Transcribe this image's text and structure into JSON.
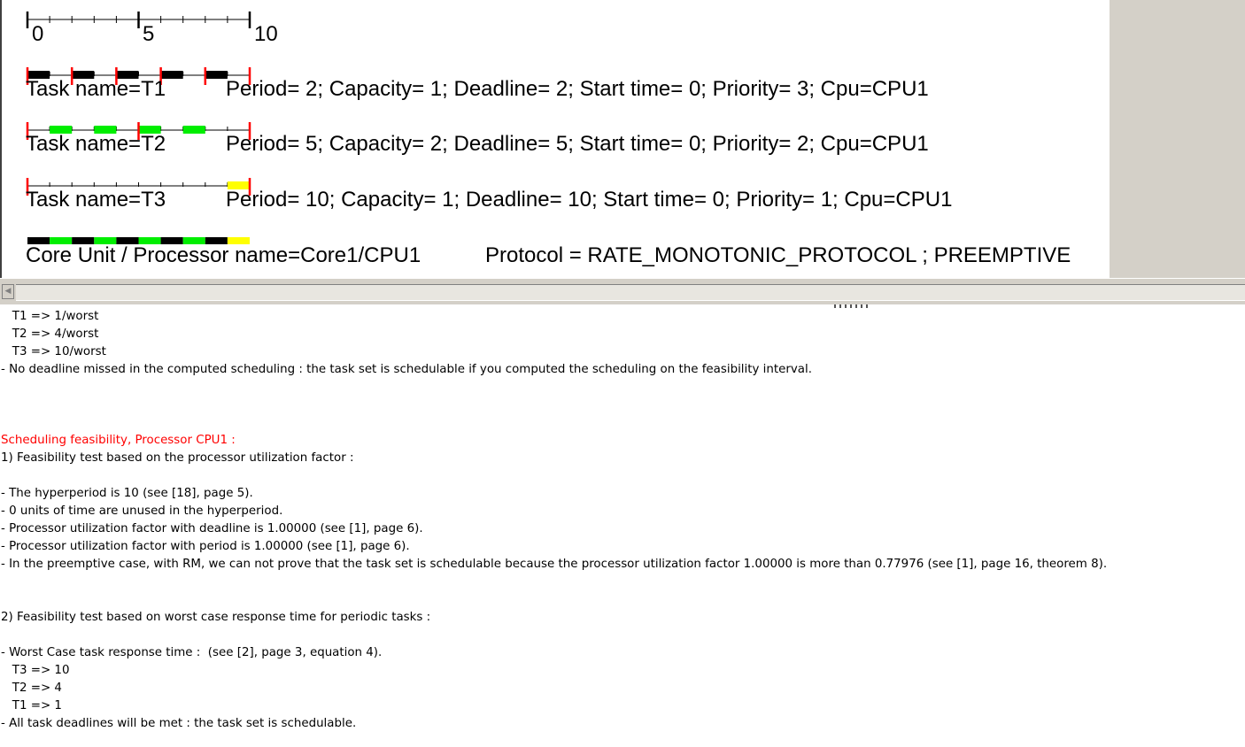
{
  "gantt": {
    "axis": {
      "start": 0,
      "end": 10,
      "labels": [
        "0",
        "5",
        "10"
      ]
    },
    "colors": {
      "T1": "#000000",
      "T2": "#00ee00",
      "T3": "#ffff00",
      "marker": "#ff0000",
      "axis": "#000000"
    },
    "tasks": [
      {
        "name": "T1",
        "label": "Task name=T1",
        "params": "Period= 2; Capacity= 1; Deadline= 2; Start time= 0; Priority= 3; Cpu=CPU1",
        "color": "#000000",
        "period": 2,
        "executions": [
          [
            0,
            1
          ],
          [
            2,
            3
          ],
          [
            4,
            5
          ],
          [
            6,
            7
          ],
          [
            8,
            9
          ]
        ]
      },
      {
        "name": "T2",
        "label": "Task name=T2",
        "params": "Period= 5; Capacity= 2; Deadline= 5; Start time= 0; Priority= 2; Cpu=CPU1",
        "color": "#00ee00",
        "period": 5,
        "executions": [
          [
            1,
            2
          ],
          [
            3,
            4
          ],
          [
            5,
            6
          ],
          [
            7,
            8
          ]
        ]
      },
      {
        "name": "T3",
        "label": "Task name=T3",
        "params": "Period= 10; Capacity= 1; Deadline= 10; Start time= 0; Priority= 1; Cpu=CPU1",
        "color": "#ffff00",
        "period": 10,
        "executions": [
          [
            9,
            10
          ]
        ]
      }
    ],
    "processor": {
      "label": "Core Unit / Processor name=Core1/CPU1",
      "protocol": "Protocol = RATE_MONOTONIC_PROTOCOL ; PREEMPTIVE",
      "timeline": [
        "T1",
        "T2",
        "T1",
        "T2",
        "T1",
        "T2",
        "T1",
        "T2",
        "T1",
        "T3"
      ]
    }
  },
  "output": {
    "lines": [
      {
        "text": "   T1 => 1/worst",
        "style": "normal"
      },
      {
        "text": "   T2 => 4/worst",
        "style": "normal"
      },
      {
        "text": "   T3 => 10/worst",
        "style": "normal"
      },
      {
        "text": "- No deadline missed in the computed scheduling : the task set is schedulable if you computed the scheduling on the feasibility interval.",
        "style": "normal"
      },
      {
        "text": "",
        "style": "normal"
      },
      {
        "text": "",
        "style": "normal"
      },
      {
        "text": "",
        "style": "normal"
      },
      {
        "text": "Scheduling feasibility, Processor CPU1 :",
        "style": "red"
      },
      {
        "text": "1) Feasibility test based on the processor utilization factor :",
        "style": "normal"
      },
      {
        "text": "",
        "style": "normal"
      },
      {
        "text": "- The hyperperiod is 10 (see [18], page 5).",
        "style": "normal"
      },
      {
        "text": "- 0 units of time are unused in the hyperperiod.",
        "style": "normal"
      },
      {
        "text": "- Processor utilization factor with deadline is 1.00000 (see [1], page 6).",
        "style": "normal"
      },
      {
        "text": "- Processor utilization factor with period is 1.00000 (see [1], page 6).",
        "style": "normal"
      },
      {
        "text": "- In the preemptive case, with RM, we can not prove that the task set is schedulable because the processor utilization factor 1.00000 is more than 0.77976 (see [1], page 16, theorem 8).",
        "style": "normal"
      },
      {
        "text": "",
        "style": "normal"
      },
      {
        "text": "",
        "style": "normal"
      },
      {
        "text": "2) Feasibility test based on worst case response time for periodic tasks :",
        "style": "normal"
      },
      {
        "text": "",
        "style": "normal"
      },
      {
        "text": "- Worst Case task response time :  (see [2], page 3, equation 4).",
        "style": "normal"
      },
      {
        "text": "   T3 => 10",
        "style": "normal"
      },
      {
        "text": "   T2 => 4",
        "style": "normal"
      },
      {
        "text": "   T1 => 1",
        "style": "normal"
      },
      {
        "text": "- All task deadlines will be met : the task set is schedulable.",
        "style": "normal"
      }
    ]
  }
}
